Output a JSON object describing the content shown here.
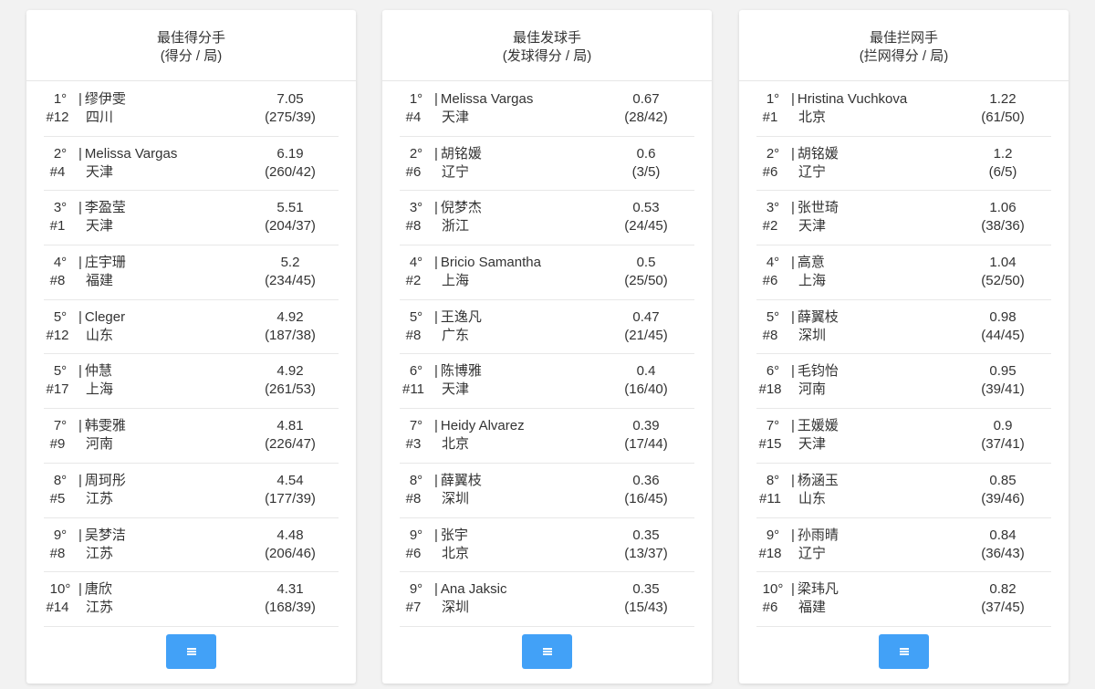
{
  "panels": [
    {
      "title": "最佳得分手",
      "subtitle": "(得分 / 局)",
      "rows": [
        {
          "rank": "1°",
          "num": "#12",
          "name": "缪伊雯",
          "team": "四川",
          "value": "7.05",
          "ratio": "(275/39)"
        },
        {
          "rank": "2°",
          "num": "#4",
          "name": "Melissa Vargas",
          "team": "天津",
          "value": "6.19",
          "ratio": "(260/42)"
        },
        {
          "rank": "3°",
          "num": "#1",
          "name": "李盈莹",
          "team": "天津",
          "value": "5.51",
          "ratio": "(204/37)"
        },
        {
          "rank": "4°",
          "num": "#8",
          "name": "庄宇珊",
          "team": "福建",
          "value": "5.2",
          "ratio": "(234/45)"
        },
        {
          "rank": "5°",
          "num": "#12",
          "name": "Cleger",
          "team": "山东",
          "value": "4.92",
          "ratio": "(187/38)"
        },
        {
          "rank": "5°",
          "num": "#17",
          "name": "仲慧",
          "team": "上海",
          "value": "4.92",
          "ratio": "(261/53)"
        },
        {
          "rank": "7°",
          "num": "#9",
          "name": "韩雯雅",
          "team": "河南",
          "value": "4.81",
          "ratio": "(226/47)"
        },
        {
          "rank": "8°",
          "num": "#5",
          "name": "周珂彤",
          "team": "江苏",
          "value": "4.54",
          "ratio": "(177/39)"
        },
        {
          "rank": "9°",
          "num": "#8",
          "name": "吴梦洁",
          "team": "江苏",
          "value": "4.48",
          "ratio": "(206/46)"
        },
        {
          "rank": "10°",
          "num": "#14",
          "name": "唐欣",
          "team": "江苏",
          "value": "4.31",
          "ratio": "(168/39)"
        }
      ]
    },
    {
      "title": "最佳发球手",
      "subtitle": "(发球得分 / 局)",
      "rows": [
        {
          "rank": "1°",
          "num": "#4",
          "name": "Melissa Vargas",
          "team": "天津",
          "value": "0.67",
          "ratio": "(28/42)"
        },
        {
          "rank": "2°",
          "num": "#6",
          "name": "胡铭媛",
          "team": "辽宁",
          "value": "0.6",
          "ratio": "(3/5)"
        },
        {
          "rank": "3°",
          "num": "#8",
          "name": "倪梦杰",
          "team": "浙江",
          "value": "0.53",
          "ratio": "(24/45)"
        },
        {
          "rank": "4°",
          "num": "#2",
          "name": "Bricio Samantha",
          "team": "上海",
          "value": "0.5",
          "ratio": "(25/50)"
        },
        {
          "rank": "5°",
          "num": "#8",
          "name": "王逸凡",
          "team": "广东",
          "value": "0.47",
          "ratio": "(21/45)"
        },
        {
          "rank": "6°",
          "num": "#11",
          "name": "陈博雅",
          "team": "天津",
          "value": "0.4",
          "ratio": "(16/40)"
        },
        {
          "rank": "7°",
          "num": "#3",
          "name": "Heidy Alvarez",
          "team": "北京",
          "value": "0.39",
          "ratio": "(17/44)"
        },
        {
          "rank": "8°",
          "num": "#8",
          "name": "薛翼枝",
          "team": "深圳",
          "value": "0.36",
          "ratio": "(16/45)"
        },
        {
          "rank": "9°",
          "num": "#6",
          "name": "张宇",
          "team": "北京",
          "value": "0.35",
          "ratio": "(13/37)"
        },
        {
          "rank": "9°",
          "num": "#7",
          "name": "Ana Jaksic",
          "team": "深圳",
          "value": "0.35",
          "ratio": "(15/43)"
        }
      ]
    },
    {
      "title": "最佳拦网手",
      "subtitle": "(拦网得分 / 局)",
      "rows": [
        {
          "rank": "1°",
          "num": "#1",
          "name": "Hristina Vuchkova",
          "team": "北京",
          "value": "1.22",
          "ratio": "(61/50)"
        },
        {
          "rank": "2°",
          "num": "#6",
          "name": "胡铭媛",
          "team": "辽宁",
          "value": "1.2",
          "ratio": "(6/5)"
        },
        {
          "rank": "3°",
          "num": "#2",
          "name": "张世琦",
          "team": "天津",
          "value": "1.06",
          "ratio": "(38/36)"
        },
        {
          "rank": "4°",
          "num": "#6",
          "name": "高意",
          "team": "上海",
          "value": "1.04",
          "ratio": "(52/50)"
        },
        {
          "rank": "5°",
          "num": "#8",
          "name": "薛翼枝",
          "team": "深圳",
          "value": "0.98",
          "ratio": "(44/45)"
        },
        {
          "rank": "6°",
          "num": "#18",
          "name": "毛钧怡",
          "team": "河南",
          "value": "0.95",
          "ratio": "(39/41)"
        },
        {
          "rank": "7°",
          "num": "#15",
          "name": "王媛媛",
          "team": "天津",
          "value": "0.9",
          "ratio": "(37/41)"
        },
        {
          "rank": "8°",
          "num": "#11",
          "name": "杨涵玉",
          "team": "山东",
          "value": "0.85",
          "ratio": "(39/46)"
        },
        {
          "rank": "9°",
          "num": "#18",
          "name": "孙雨晴",
          "team": "辽宁",
          "value": "0.84",
          "ratio": "(36/43)"
        },
        {
          "rank": "10°",
          "num": "#6",
          "name": "梁玮凡",
          "team": "福建",
          "value": "0.82",
          "ratio": "(37/45)"
        }
      ]
    }
  ],
  "menu_button": {
    "icon": "menu-icon",
    "color": "#42a1f7"
  }
}
